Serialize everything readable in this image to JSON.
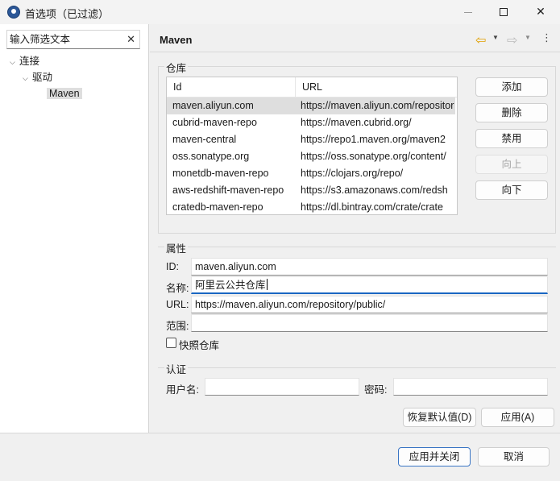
{
  "window": {
    "title": "首选项（已过滤）",
    "close_glyph": "✕"
  },
  "filter": {
    "placeholder": "输入筛选文本",
    "clear_glyph": "✕"
  },
  "tree": [
    {
      "label": "连接",
      "expanded": true
    },
    {
      "label": "驱动",
      "expanded": true
    },
    {
      "label": "Maven",
      "selected": true
    }
  ],
  "page": {
    "title": "Maven"
  },
  "nav": {
    "back_glyph": "⇦",
    "forward_glyph": "⇨",
    "dropdown_glyph": "▼",
    "menu_glyph": "⋮"
  },
  "repositories": {
    "group_label": "仓库",
    "columns": [
      "Id",
      "URL"
    ],
    "rows": [
      {
        "id": "maven.aliyun.com",
        "url": "https://maven.aliyun.com/repositor",
        "selected": true
      },
      {
        "id": "cubrid-maven-repo",
        "url": "https://maven.cubrid.org/"
      },
      {
        "id": "maven-central",
        "url": "https://repo1.maven.org/maven2"
      },
      {
        "id": "oss.sonatype.org",
        "url": "https://oss.sonatype.org/content/"
      },
      {
        "id": "monetdb-maven-repo",
        "url": "https://clojars.org/repo/"
      },
      {
        "id": "aws-redshift-maven-repo",
        "url": "https://s3.amazonaws.com/redsh"
      },
      {
        "id": "cratedb-maven-repo",
        "url": "https://dl.bintray.com/crate/crate"
      }
    ],
    "buttons": {
      "add": "添加",
      "delete": "删除",
      "disable": "禁用",
      "up": "向上",
      "down": "向下"
    }
  },
  "properties": {
    "group_label": "属性",
    "id_label": "ID:",
    "id_value": "maven.aliyun.com",
    "name_label": "名称:",
    "name_value": "阿里云公共仓库",
    "url_label": "URL:",
    "url_value": "https://maven.aliyun.com/repository/public/",
    "scope_label": "范围:",
    "scope_value": "",
    "snapshot_label": "快照仓库",
    "snapshot_checked": false
  },
  "auth": {
    "group_label": "认证",
    "username_label": "用户名:",
    "username_value": "",
    "password_label": "密码:",
    "password_value": ""
  },
  "actions": {
    "restore_defaults": "恢复默认值(D)",
    "apply": "应用(A)",
    "apply_close": "应用并关闭",
    "cancel": "取消"
  }
}
